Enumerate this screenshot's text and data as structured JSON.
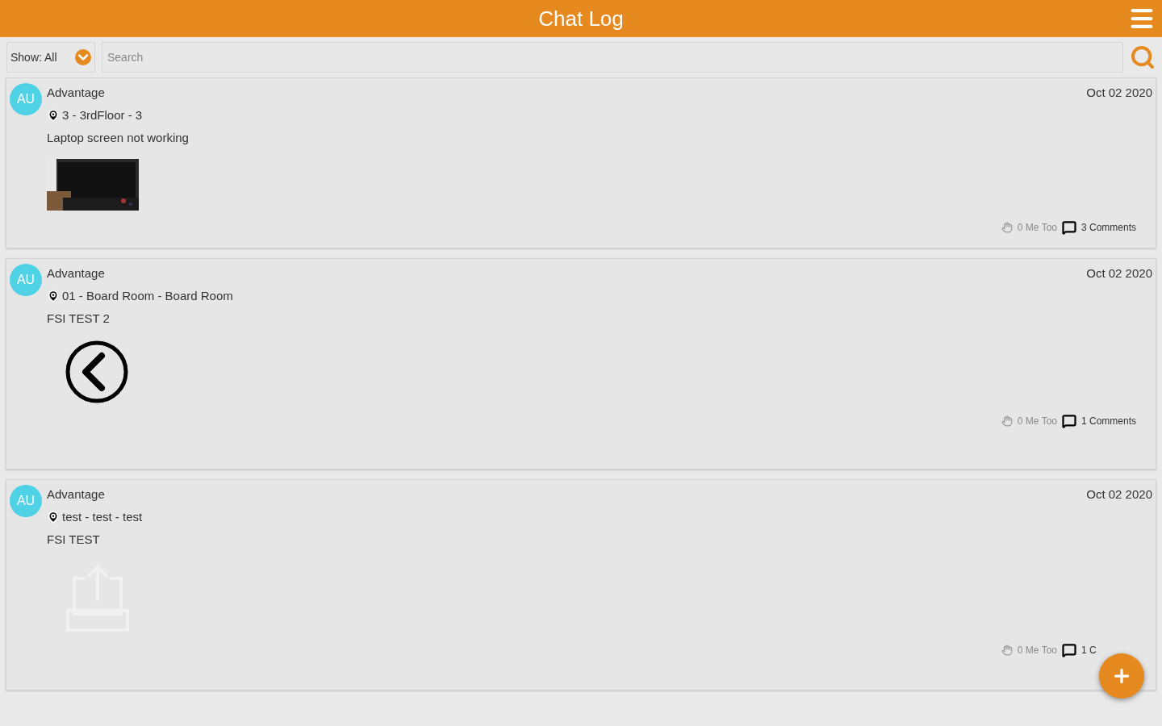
{
  "header": {
    "title": "Chat Log"
  },
  "filter": {
    "label": "Show: All"
  },
  "search": {
    "placeholder": "Search"
  },
  "posts": [
    {
      "avatar": "AU",
      "author": "Advantage",
      "date": "Oct 02 2020",
      "location": "3 - 3rdFloor - 3",
      "message": "Laptop screen not working",
      "me_too": "0 Me Too",
      "comments": "3 Comments"
    },
    {
      "avatar": "AU",
      "author": "Advantage",
      "date": "Oct 02 2020",
      "location": "01 - Board Room - Board Room",
      "message": "FSI TEST 2",
      "attachment": {
        "kind": "back-arrow"
      },
      "me_too": "0 Me Too",
      "comments": "1 Comments"
    },
    {
      "avatar": "AU",
      "author": "Advantage",
      "date": "Oct 02 2020",
      "location": "test - test - test",
      "message": "FSI TEST",
      "attachment": {
        "kind": "upload"
      },
      "me_too": "0 Me Too",
      "comments": "1 C"
    }
  ]
}
